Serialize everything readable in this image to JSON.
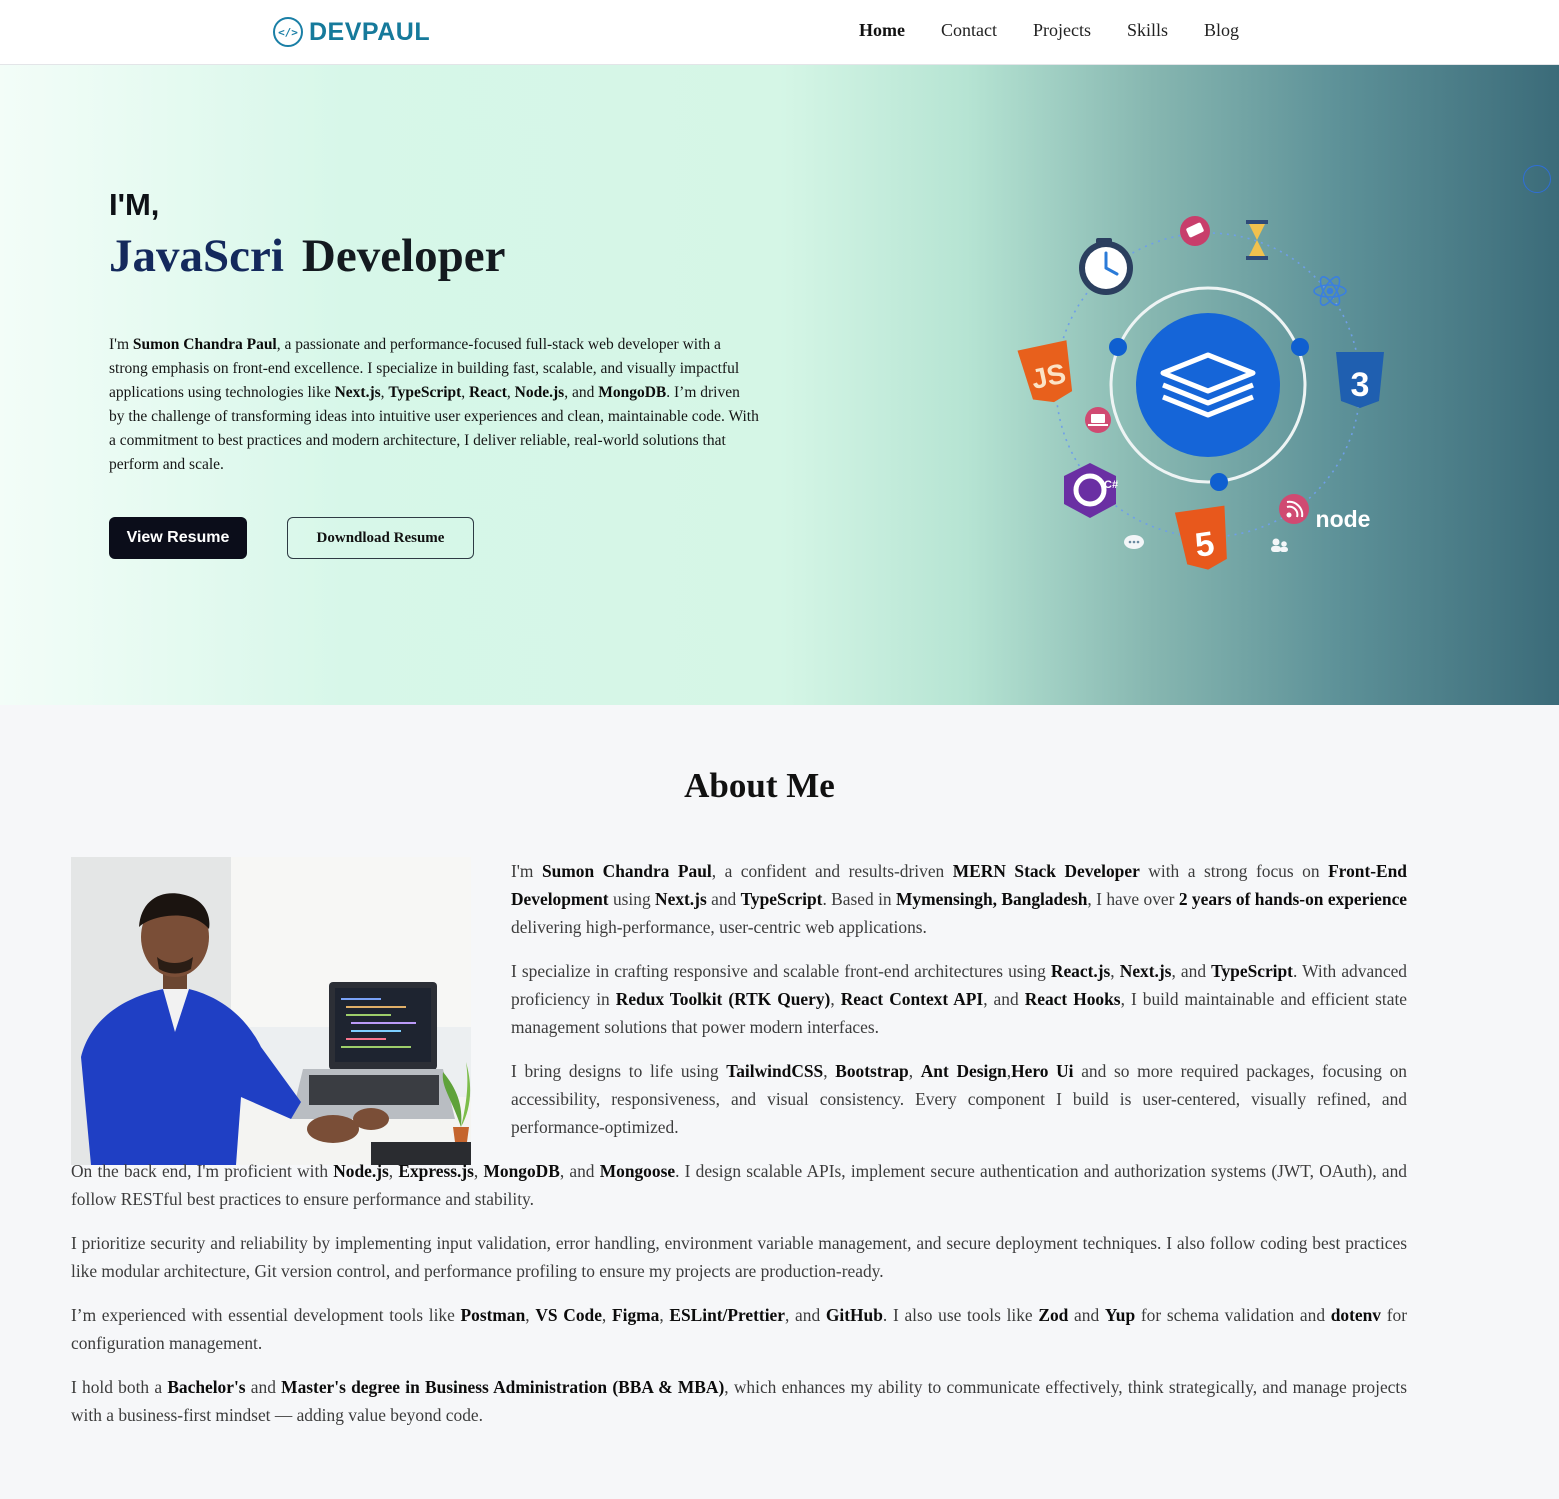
{
  "header": {
    "logo_code": "</>",
    "logo_text": "DEVPAUL",
    "nav": [
      "Home",
      "Contact",
      "Projects",
      "Skills",
      "Blog"
    ]
  },
  "hero": {
    "greeting": "I'M,",
    "typed_text": "JavaScri",
    "role_suffix": "Developer",
    "description": [
      {
        "t": "I'm "
      },
      {
        "b": "Sumon Chandra Paul"
      },
      {
        "t": ", a passionate and performance-focused full-stack web developer with a strong emphasis on front-end excellence. I specialize in building fast, scalable, and visually impactful applications using technologies like "
      },
      {
        "b": "Next.js"
      },
      {
        "t": ", "
      },
      {
        "b": "TypeScript"
      },
      {
        "t": ", "
      },
      {
        "b": "React"
      },
      {
        "t": ", "
      },
      {
        "b": "Node.js"
      },
      {
        "t": ", and "
      },
      {
        "b": "MongoDB"
      },
      {
        "t": ". I’m driven by the challenge of transforming ideas into intuitive user experiences and clean, maintainable code. With a commitment to best practices and modern architecture, I deliver reliable, real-world solutions that perform and scale."
      }
    ],
    "view_resume": "View Resume",
    "download_resume": "Downdload Resume",
    "icon_labels": {
      "js": "JS",
      "css": "3",
      "html": "5",
      "csharp": "C#",
      "node": "node"
    }
  },
  "about": {
    "title": "About Me",
    "paragraphs": [
      [
        {
          "t": "I'm "
        },
        {
          "b": "Sumon Chandra Paul"
        },
        {
          "t": ", a confident and results-driven "
        },
        {
          "b": "MERN Stack Developer"
        },
        {
          "t": " with a strong focus on "
        },
        {
          "b": "Front-End Development"
        },
        {
          "t": " using "
        },
        {
          "b": "Next.js"
        },
        {
          "t": " and "
        },
        {
          "b": "TypeScript"
        },
        {
          "t": ". Based in "
        },
        {
          "b": "Mymensingh, Bangladesh"
        },
        {
          "t": ", I have over "
        },
        {
          "b": "2 years of hands-on experience"
        },
        {
          "t": " delivering high-performance, user-centric web applications."
        }
      ],
      [
        {
          "t": "I specialize in crafting responsive and scalable front-end architectures using "
        },
        {
          "b": "React.js"
        },
        {
          "t": ", "
        },
        {
          "b": "Next.js"
        },
        {
          "t": ", and "
        },
        {
          "b": "TypeScript"
        },
        {
          "t": ". With advanced proficiency in "
        },
        {
          "b": "Redux Toolkit (RTK Query)"
        },
        {
          "t": ", "
        },
        {
          "b": "React Context API"
        },
        {
          "t": ", and "
        },
        {
          "b": "React Hooks"
        },
        {
          "t": ", I build maintainable and efficient state management solutions that power modern interfaces."
        }
      ],
      [
        {
          "t": "I bring designs to life using "
        },
        {
          "b": "TailwindCSS"
        },
        {
          "t": ", "
        },
        {
          "b": "Bootstrap"
        },
        {
          "t": ", "
        },
        {
          "b": "Ant Design"
        },
        {
          "t": ","
        },
        {
          "b": "Hero Ui"
        },
        {
          "t": " and so more required packages, focusing on accessibility, responsiveness, and visual consistency. Every component I build is user-centered, visually refined, and performance-optimized."
        }
      ],
      [
        {
          "t": "On the back end, I'm proficient with "
        },
        {
          "b": "Node.js"
        },
        {
          "t": ", "
        },
        {
          "b": "Express.js"
        },
        {
          "t": ", "
        },
        {
          "b": "MongoDB"
        },
        {
          "t": ", and "
        },
        {
          "b": "Mongoose"
        },
        {
          "t": ". I design scalable APIs, implement secure authentication and authorization systems (JWT, OAuth), and follow RESTful best practices to ensure performance and stability."
        }
      ],
      [
        {
          "t": "I prioritize security and reliability by implementing input validation, error handling, environment variable management, and secure deployment techniques. I also follow coding best practices like modular architecture, Git version control, and performance profiling to ensure my projects are production-ready."
        }
      ],
      [
        {
          "t": "I’m experienced with essential development tools like "
        },
        {
          "b": "Postman"
        },
        {
          "t": ", "
        },
        {
          "b": "VS Code"
        },
        {
          "t": ", "
        },
        {
          "b": "Figma"
        },
        {
          "t": ", "
        },
        {
          "b": "ESLint/Prettier"
        },
        {
          "t": ", and "
        },
        {
          "b": "GitHub"
        },
        {
          "t": ". I also use tools like "
        },
        {
          "b": "Zod"
        },
        {
          "t": " and "
        },
        {
          "b": "Yup"
        },
        {
          "t": " for schema validation and "
        },
        {
          "b": "dotenv"
        },
        {
          "t": " for configuration management."
        }
      ],
      [
        {
          "t": "I hold both a "
        },
        {
          "b": "Bachelor's"
        },
        {
          "t": " and "
        },
        {
          "b": "Master's degree in Business Administration (BBA & MBA)"
        },
        {
          "t": ", which enhances my ability to communicate effectively, think strategically, and manage projects with a business-first mindset — adding value beyond code."
        }
      ]
    ]
  },
  "colors": {
    "accent": "#167a9b",
    "button_dark": "#0b0d1a",
    "heading_blue": "#14295c"
  }
}
